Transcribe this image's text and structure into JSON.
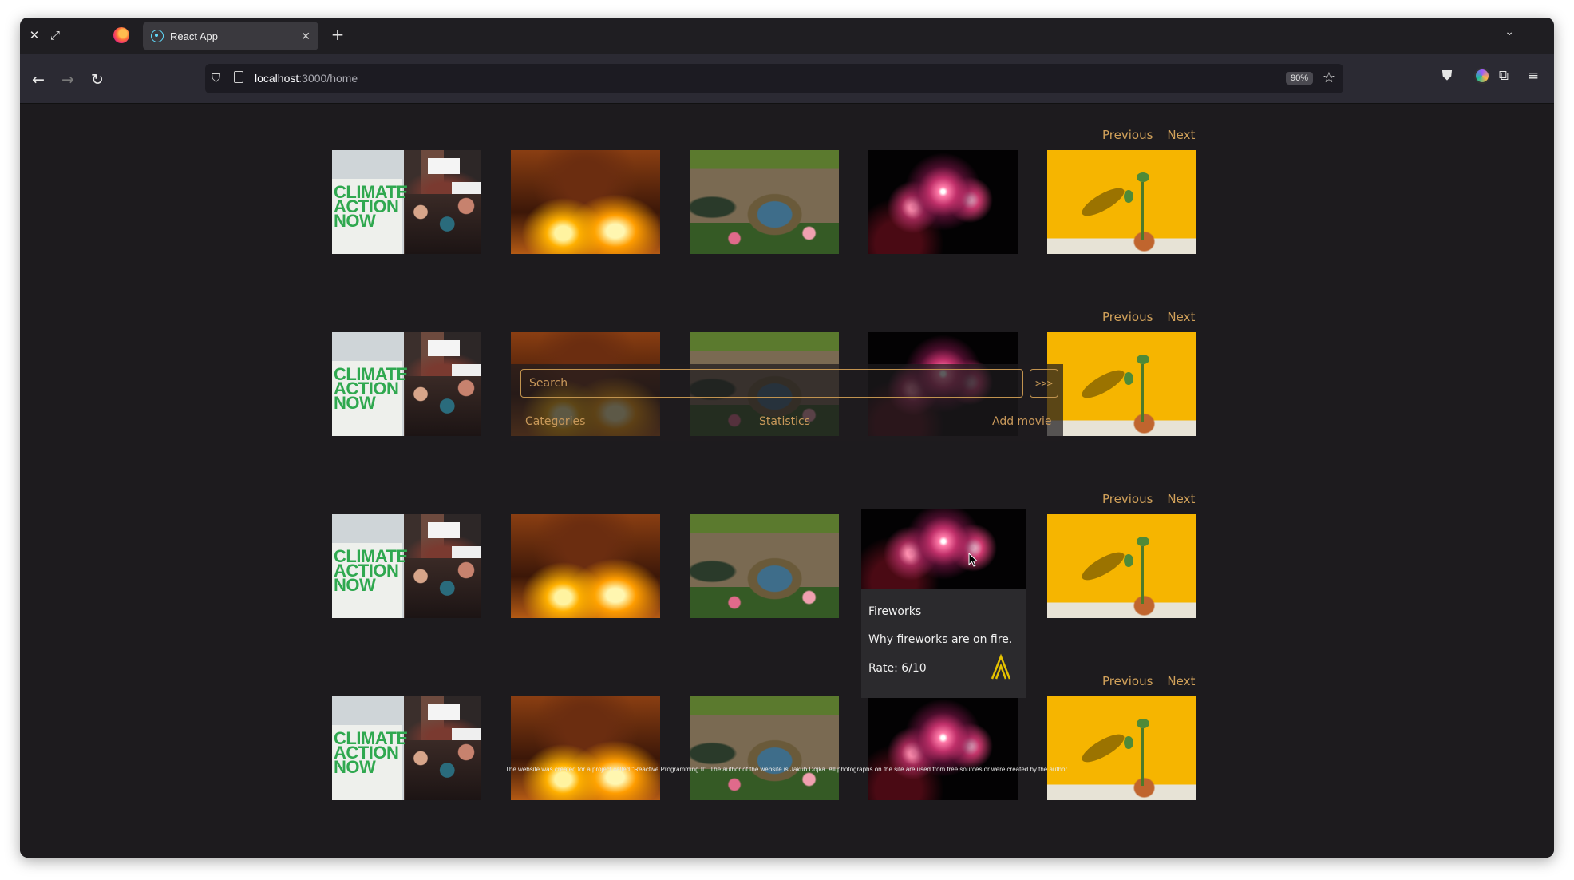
{
  "browser": {
    "tab_title": "React App",
    "url_host": "localhost",
    "url_path": ":3000/home",
    "zoom": "90%"
  },
  "rows": [
    {
      "previous_label": "Previous",
      "next_label": "Next"
    },
    {
      "previous_label": "Previous",
      "next_label": "Next"
    },
    {
      "previous_label": "Previous",
      "next_label": "Next"
    },
    {
      "previous_label": "Previous",
      "next_label": "Next"
    }
  ],
  "images": [
    {
      "name": "climate-protest-image"
    },
    {
      "name": "fire-explosion-image"
    },
    {
      "name": "hobbit-house-image"
    },
    {
      "name": "fireworks-image"
    },
    {
      "name": "plant-sprout-image"
    }
  ],
  "climate_sign": {
    "line1": "CLIMATE",
    "line2": "ACTION",
    "line3": "NOW"
  },
  "search": {
    "placeholder": "Search",
    "button_label": ">>>"
  },
  "menu": {
    "categories": "Categories",
    "statistics": "Statistics",
    "add_movie": "Add movie"
  },
  "hover_card": {
    "title": "Fireworks",
    "description": "Why fireworks are on fire.",
    "rate": "Rate: 6/10"
  },
  "footer": {
    "text": "The website was created for a project called \"Reactive Programming II\". The author of the website is Jakub Dojka. All photographs on the site are used from free sources or were created by the author."
  },
  "colors": {
    "accent": "#d1a15a",
    "page_bg": "#1d1b1e",
    "card_bg": "#2b2a2d"
  }
}
